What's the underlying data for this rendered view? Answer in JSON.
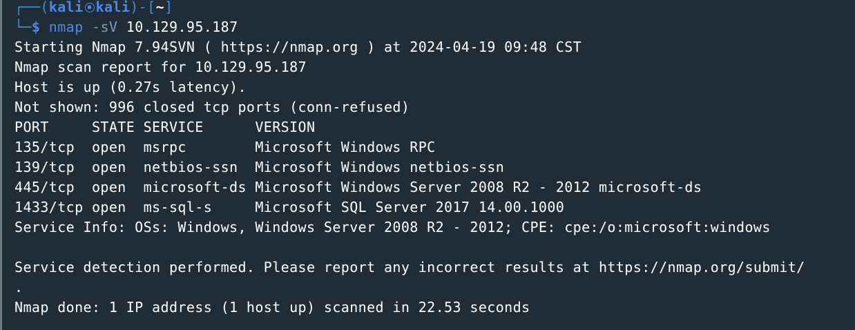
{
  "prompt": {
    "frame_top": "┌──(",
    "user": "kali",
    "host": "kali",
    "frame_mid": ")-[",
    "cwd": "~",
    "frame_end": "]",
    "frame_bottom": "└─",
    "symbol": "$",
    "command": "nmap",
    "flag": "-sV",
    "target": "10.129.95.187"
  },
  "output": [
    "Starting Nmap 7.94SVN ( https://nmap.org ) at 2024-04-19 09:48 CST",
    "Nmap scan report for 10.129.95.187",
    "Host is up (0.27s latency).",
    "Not shown: 996 closed tcp ports (conn-refused)",
    "PORT     STATE SERVICE      VERSION",
    "135/tcp  open  msrpc        Microsoft Windows RPC",
    "139/tcp  open  netbios-ssn  Microsoft Windows netbios-ssn",
    "445/tcp  open  microsoft-ds Microsoft Windows Server 2008 R2 - 2012 microsoft-ds",
    "1433/tcp open  ms-sql-s     Microsoft SQL Server 2017 14.00.1000",
    "Service Info: OSs: Windows, Windows Server 2008 R2 - 2012; CPE: cpe:/o:microsoft:windows",
    "",
    "Service detection performed. Please report any incorrect results at https://nmap.org/submit/",
    ".",
    "Nmap done: 1 IP address (1 host up) scanned in 22.53 seconds"
  ],
  "colors": {
    "background": "#212d36",
    "prompt_blue": "#4f86ea",
    "flag_gray": "#8f96b8",
    "text": "#ffffff"
  }
}
